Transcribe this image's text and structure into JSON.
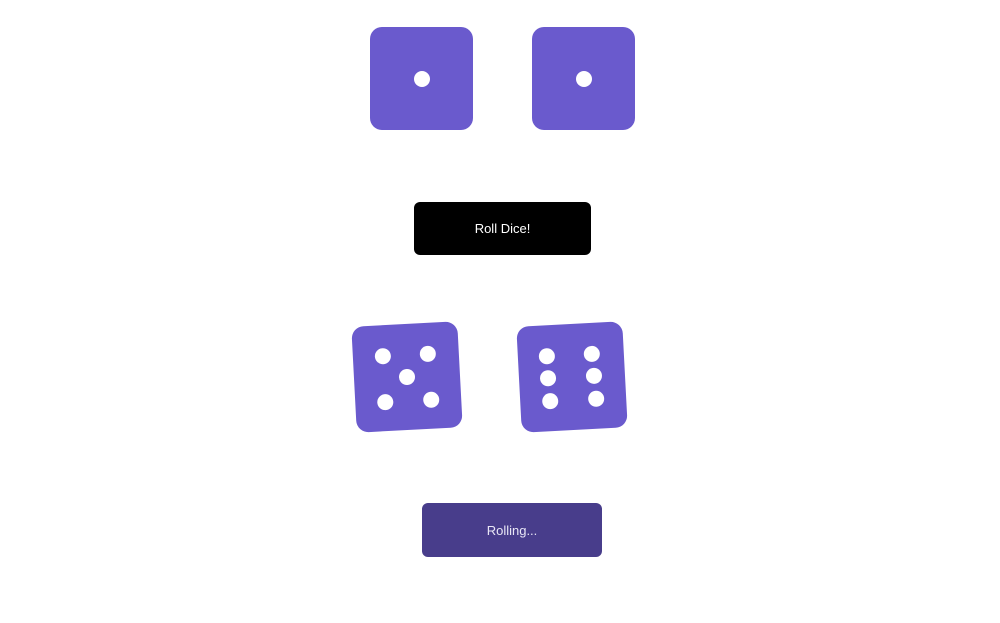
{
  "colors": {
    "die_face": "#6a5acd",
    "pip": "#ffffff",
    "roll_button": "#000000",
    "rolling_button": "#483d8b"
  },
  "top_dice": [
    {
      "value": 1
    },
    {
      "value": 1
    }
  ],
  "roll_button": {
    "label": "Roll Dice!"
  },
  "bottom_dice": [
    {
      "value": 5
    },
    {
      "value": 6
    }
  ],
  "rolling_button": {
    "label": "Rolling..."
  }
}
